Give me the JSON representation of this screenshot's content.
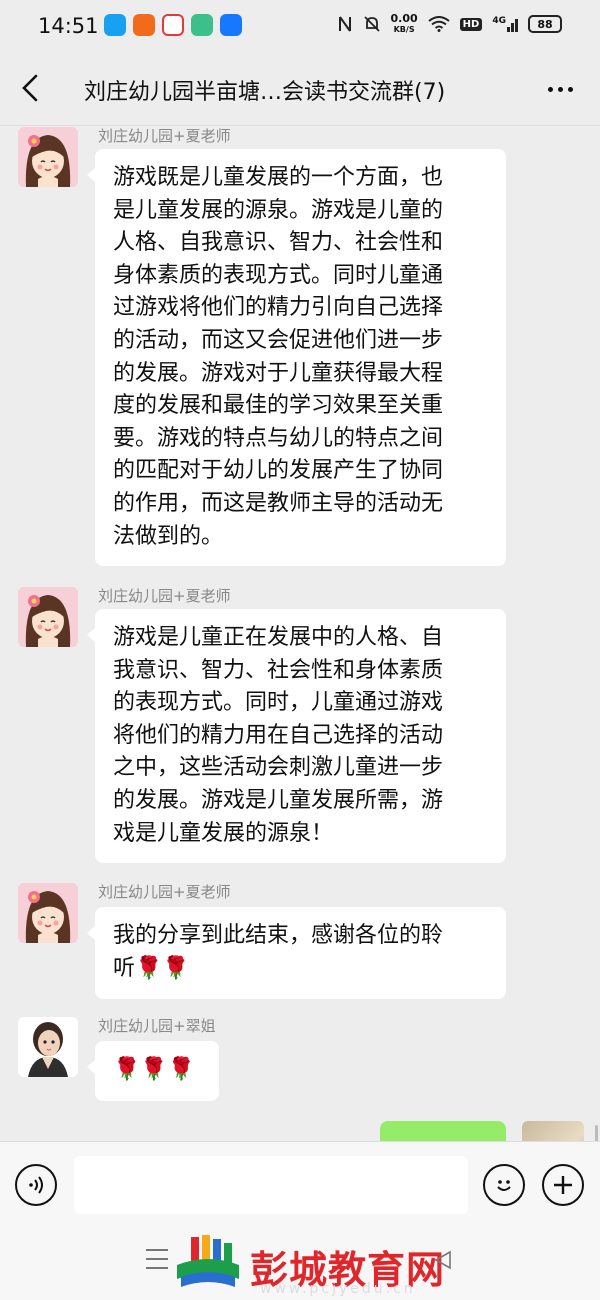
{
  "status_bar": {
    "time": "14:51",
    "net_speed_value": "0.00",
    "net_speed_unit": "KB/S",
    "hd_label": "HD",
    "signal_label": "4G",
    "battery": "88",
    "app_icons": [
      {
        "name": "qq-icon",
        "color": "#1aa0f0"
      },
      {
        "name": "taobao-icon",
        "color": "#f26b1d"
      },
      {
        "name": "maps-icon",
        "color": "#e03a3a"
      },
      {
        "name": "app-green-icon",
        "color": "#3cbf8a"
      },
      {
        "name": "alipay-icon",
        "color": "#1677ff"
      }
    ]
  },
  "header": {
    "title": "刘庄幼儿园半亩塘…会读书交流群(7)"
  },
  "messages": [
    {
      "sender": "刘庄幼儿园+夏老师",
      "lines": [
        "游戏既是儿童发展的一个方面，也",
        "是儿童发展的源泉。游戏是儿童的",
        "人格、自我意识、智力、社会性和",
        "身体素质的表现方式。同时儿童通",
        "过游戏将他们的精力引向自己选择",
        "的活动，而这又会促进他们进一步",
        "的发展。游戏对于儿童获得最大程",
        "度的发展和最佳的学习效果至关重",
        "要。游戏的特点与幼儿的特点之间",
        "的匹配对于幼儿的发展产生了协同",
        "的作用，而这是教师主导的活动无",
        "法做到的。"
      ]
    },
    {
      "sender": "刘庄幼儿园+夏老师",
      "lines": [
        "游戏是儿童正在发展中的人格、自",
        "我意识、智力、社会性和身体素质",
        "的表现方式。同时，儿童通过游戏",
        "将他们的精力用在自己选择的活动",
        "之中，这些活动会刺激儿童进一步",
        "的发展。游戏是儿童发展所需，游",
        "戏是儿童发展的源泉！"
      ]
    },
    {
      "sender": "刘庄幼儿园+夏老师",
      "lines": [
        "我的分享到此结束，感谢各位的聆",
        "听🌹🌹"
      ]
    },
    {
      "sender": "刘庄幼儿园+翠姐",
      "lines": [
        "🌹🌹🌹"
      ]
    }
  ],
  "footer": {
    "logo_text": "彭城教育网",
    "logo_url": "www.pcjyedu.cn"
  }
}
